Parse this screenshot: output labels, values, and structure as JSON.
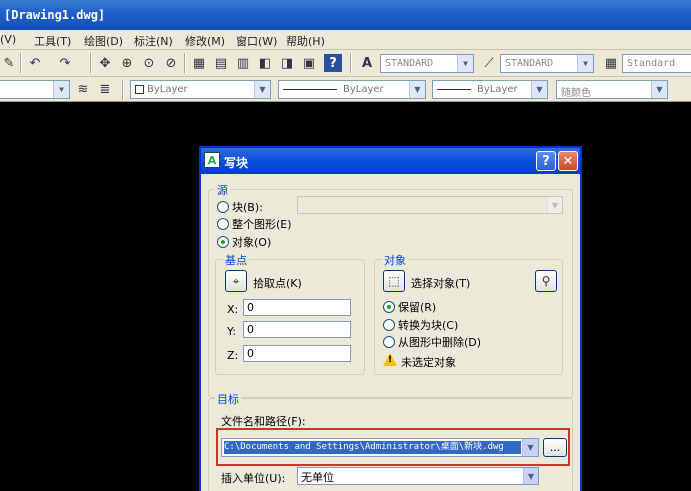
{
  "window": {
    "title": "[Drawing1.dwg]"
  },
  "menu": [
    "(V)",
    "工具(T)",
    "绘图(D)",
    "标注(N)",
    "修改(M)",
    "窗口(W)",
    "帮助(H)"
  ],
  "toolbar": {
    "text_style": "STANDARD",
    "dim_style": "STANDARD",
    "table_style": "Standard",
    "color_combo": "ByLayer",
    "linetype_combo": "ByLayer",
    "lineweight_combo": "ByLayer",
    "plotstyle_combo": "随颜色"
  },
  "dialog": {
    "title": "写块",
    "help_glyph": "?",
    "close_glyph": "✕",
    "source": {
      "legend": "源",
      "block": "块(B):",
      "entire": "整个图形(E)",
      "objects": "对象(O)",
      "selected": "objects"
    },
    "base": {
      "legend": "基点",
      "pick_label": "拾取点(K)",
      "x_label": "X:",
      "x": "0",
      "y_label": "Y:",
      "y": "0",
      "z_label": "Z:",
      "z": "0"
    },
    "objects": {
      "legend": "对象",
      "select_label": "选择对象(T)",
      "retain": "保留(R)",
      "convert": "转换为块(C)",
      "delete": "从图形中删除(D)",
      "selected": "retain",
      "status": "未选定对象"
    },
    "target": {
      "legend": "目标",
      "path_label": "文件名和路径(F):",
      "path_value": "C:\\Documents and Settings\\Administrator\\桌面\\新块.dwg",
      "browse_label": "...",
      "units_label": "插入单位(U):",
      "units_value": "无单位"
    }
  },
  "colors": {
    "title_blue": "#1f5fc8",
    "dialog_bg": "#ece9d8",
    "highlight_red": "#c0392b",
    "group_legend": "#0046d5"
  }
}
